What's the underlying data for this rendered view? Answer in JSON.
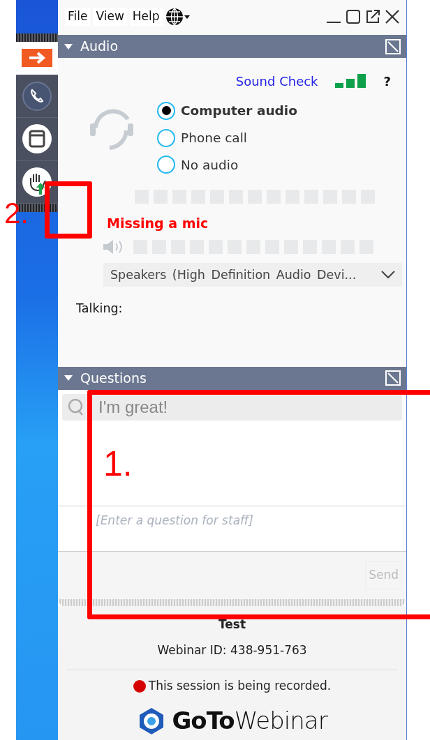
{
  "menu": [
    {
      "label": "File"
    },
    {
      "label": "View"
    },
    {
      "label": "Help"
    }
  ],
  "sidebar": {
    "items": [
      {
        "kind": "arrow",
        "selected": true
      },
      {
        "kind": "phone",
        "selected": false
      },
      {
        "kind": "window",
        "selected": false
      },
      {
        "kind": "hand",
        "selected": false
      }
    ]
  },
  "audio": {
    "title": "Audio",
    "expanded": true,
    "sound_check": "Sound Check",
    "help": "?",
    "options": [
      {
        "label": "Computer audio",
        "selected": true
      },
      {
        "label": "Phone call",
        "selected": false
      },
      {
        "label": "No audio",
        "selected": false
      }
    ],
    "mic_meter": {
      "level": 0
    },
    "mic_status": "Missing a mic",
    "speaker_meter": {
      "level": 0
    },
    "speaker_device": "Speakers (High Definition Audio Devi...",
    "talking_label": "Talking:"
  },
  "questions": {
    "title": "Questions",
    "expanded": true,
    "search_value": "I'm great!",
    "input_placeholder": "[Enter a question for staff]",
    "send": "Send",
    "send_disabled": true
  },
  "footer": {
    "title": "Test",
    "webinar_id": "Webinar ID: 438-951-763",
    "recording": "This session is being recorded.",
    "logo_bold": "GoTo",
    "logo_light": "Webinar"
  },
  "annotations": [
    {
      "label": "1."
    },
    {
      "label": "2."
    }
  ]
}
